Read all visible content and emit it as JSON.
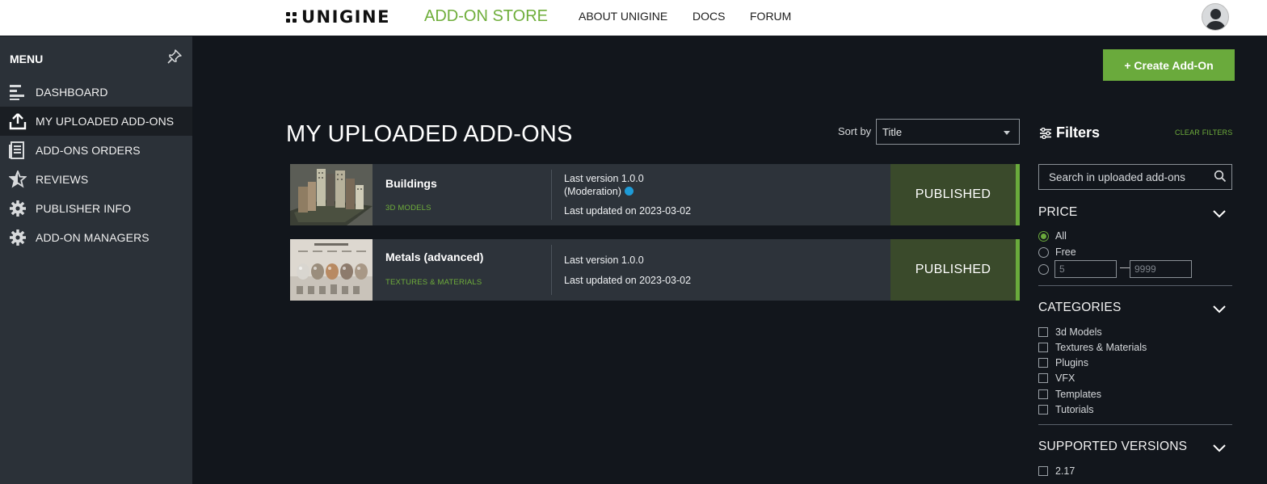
{
  "header": {
    "logo_text": "UNIGINE",
    "store_title": "ADD-ON STORE",
    "nav": [
      "ABOUT UNIGINE",
      "DOCS",
      "FORUM"
    ]
  },
  "sidebar": {
    "title": "MENU",
    "items": [
      {
        "label": "DASHBOARD",
        "icon": "dashboard-icon"
      },
      {
        "label": "MY UPLOADED ADD-ONS",
        "icon": "upload-icon",
        "active": true
      },
      {
        "label": "ADD-ONS ORDERS",
        "icon": "orders-icon"
      },
      {
        "label": "REVIEWS",
        "icon": "star-icon"
      },
      {
        "label": "PUBLISHER INFO",
        "icon": "gear-icon"
      },
      {
        "label": "ADD-ON MANAGERS",
        "icon": "gear-icon"
      }
    ]
  },
  "main": {
    "create_button": "+ Create Add-On",
    "title": "MY UPLOADED ADD-ONS",
    "sort_label": "Sort by",
    "sort_value": "Title",
    "addons": [
      {
        "name": "Buildings",
        "category": "3D MODELS",
        "version": "Last version 1.0.0",
        "moderation": "(Moderation)",
        "updated": "Last updated on 2023-03-02",
        "status": "PUBLISHED"
      },
      {
        "name": "Metals (advanced)",
        "category": "TEXTURES & MATERIALS",
        "version": "Last version 1.0.0",
        "updated": "Last updated on 2023-03-02",
        "status": "PUBLISHED"
      }
    ]
  },
  "filters": {
    "title": "Filters",
    "clear": "CLEAR FILTERS",
    "search_placeholder": "Search in uploaded add-ons",
    "price": {
      "title": "PRICE",
      "options": [
        "All",
        "Free"
      ],
      "selected": "All",
      "min_placeholder": "5",
      "max_placeholder": "9999",
      "dash": "—"
    },
    "categories": {
      "title": "CATEGORIES",
      "items": [
        "3d Models",
        "Textures & Materials",
        "Plugins",
        "VFX",
        "Templates",
        "Tutorials"
      ]
    },
    "versions": {
      "title": "SUPPORTED VERSIONS",
      "items": [
        "2.17"
      ]
    }
  },
  "colors": {
    "accent": "#6aaa3c",
    "sidebar": "#2b3138",
    "background": "#12161c",
    "status_bg": "#3a4a2b",
    "moderation_dot": "#1e9bd7"
  }
}
